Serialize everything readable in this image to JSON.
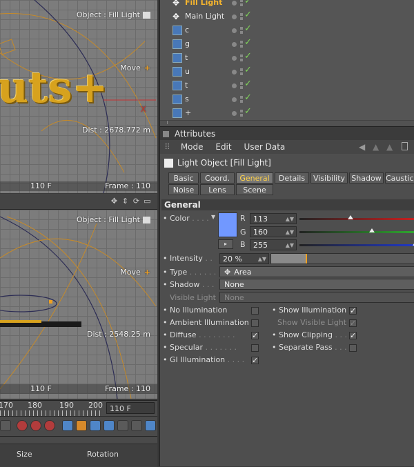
{
  "viewport_top": {
    "object_label": "Object : Fill Light",
    "move_label": "Move",
    "dist_label": "Dist : 2678.772 m",
    "frame_left": "110 F",
    "frame_right": "Frame : 110",
    "logo_text": "uts+"
  },
  "viewport_bottom": {
    "object_label": "Object : Fill Light",
    "move_label": "Move",
    "dist_label": "Dist : 2548.25 m",
    "frame_left": "110 F",
    "frame_right": "Frame : 110"
  },
  "timeline": {
    "ticks": [
      "170",
      "180",
      "190",
      "200"
    ],
    "frame_field": "110 F"
  },
  "coordinates": {
    "size_header": "Size",
    "rotation_header": "Rotation"
  },
  "object_manager": {
    "items": [
      {
        "name": "Fill Light",
        "icon": "light-icon",
        "active": true
      },
      {
        "name": "Main Light",
        "icon": "light-icon",
        "active": false
      },
      {
        "name": "c",
        "icon": "text-spline-icon",
        "active": false
      },
      {
        "name": "g",
        "icon": "text-spline-icon",
        "active": false
      },
      {
        "name": "t",
        "icon": "text-spline-icon",
        "active": false
      },
      {
        "name": "u",
        "icon": "text-spline-icon",
        "active": false
      },
      {
        "name": "t",
        "icon": "text-spline-icon",
        "active": false
      },
      {
        "name": "s",
        "icon": "text-spline-icon",
        "active": false
      },
      {
        "name": "+",
        "icon": "text-spline-icon",
        "active": false
      }
    ]
  },
  "attributes": {
    "title": "Attributes",
    "menu": [
      "Mode",
      "Edit",
      "User Data"
    ],
    "object_title": "Light Object [Fill Light]",
    "tabs_row1": [
      "Basic",
      "Coord.",
      "General",
      "Details",
      "Visibility",
      "Shadow",
      "Caustics"
    ],
    "tabs_row2": [
      "Noise",
      "Lens",
      "Scene"
    ],
    "active_tab": "General",
    "section": "General",
    "color_label": "Color",
    "color_swatch": "#7198ff",
    "r_label": "R",
    "r_value": "113",
    "g_label": "G",
    "g_value": "160",
    "b_label": "B",
    "b_value": "255",
    "r_fraction": 0.443,
    "g_fraction": 0.627,
    "b_fraction": 1.0,
    "intensity_label": "Intensity",
    "intensity_value": "20 %",
    "intensity_fraction": 0.2,
    "type_label": "Type",
    "type_value": "Area",
    "shadow_label": "Shadow",
    "shadow_value": "None",
    "visible_light_label": "Visible Light",
    "visible_light_value": "None",
    "checks": {
      "no_illumination": {
        "label": "No Illumination",
        "checked": false
      },
      "ambient_illumination": {
        "label": "Ambient Illumination",
        "checked": false
      },
      "diffuse": {
        "label": "Diffuse",
        "checked": true
      },
      "specular": {
        "label": "Specular",
        "checked": false
      },
      "gi_illumination": {
        "label": "GI Illumination",
        "checked": true
      },
      "show_illumination": {
        "label": "Show Illumination",
        "checked": true
      },
      "show_visible_light": {
        "label": "Show Visible Light",
        "checked": true
      },
      "show_clipping": {
        "label": "Show Clipping",
        "checked": true
      },
      "separate_pass": {
        "label": "Separate Pass",
        "checked": false
      }
    },
    "check_glyph": "✓"
  }
}
